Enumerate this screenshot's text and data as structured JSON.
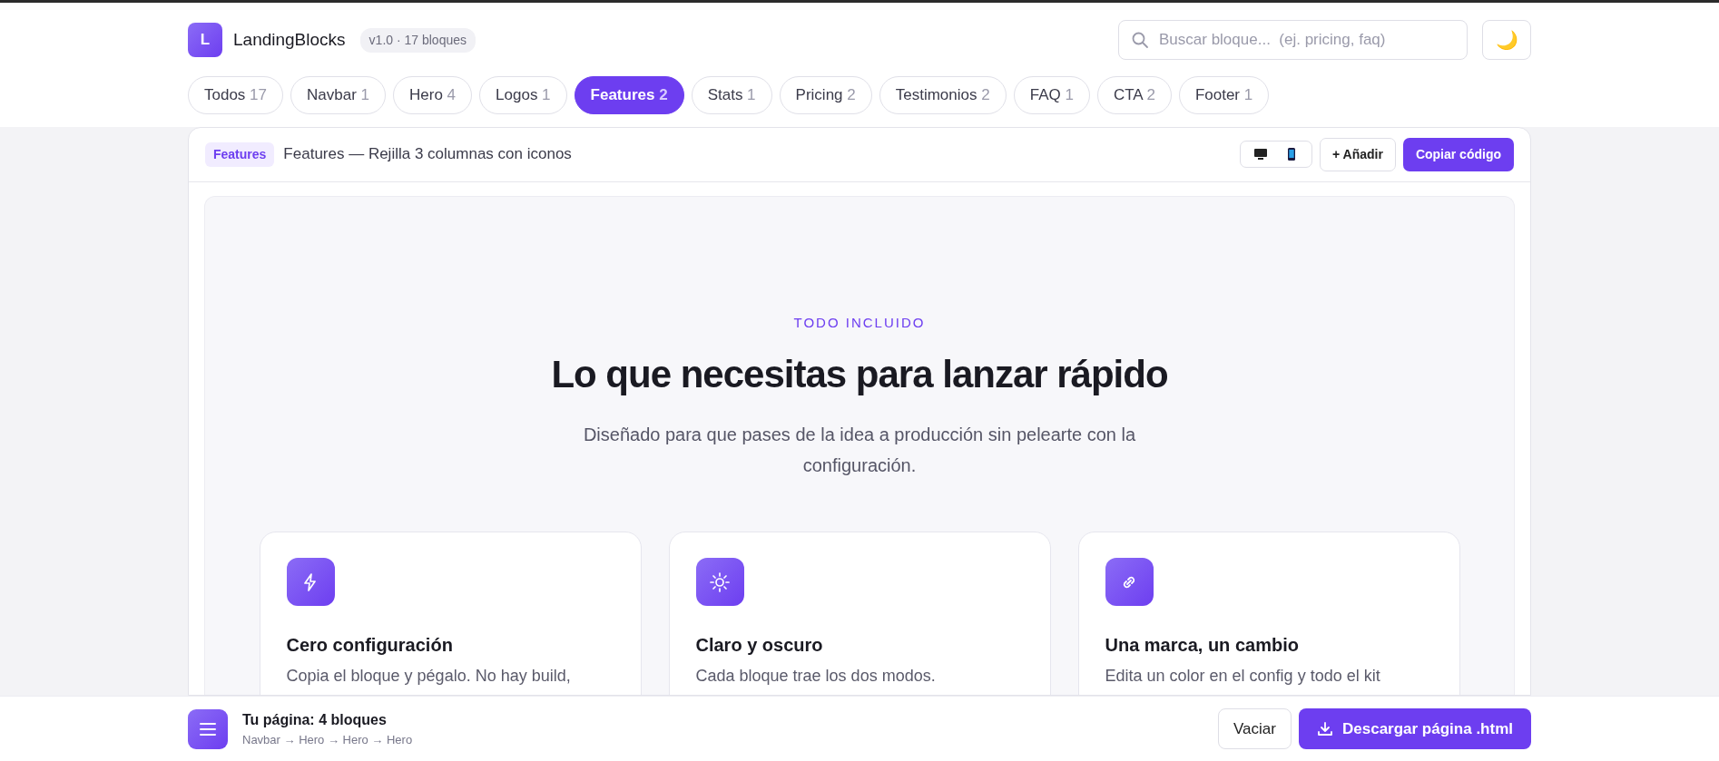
{
  "brand": {
    "logo_letter": "L",
    "name": "LandingBlocks",
    "version": "v1.0 · 17 bloques"
  },
  "search": {
    "placeholder": "Buscar bloque...  (ej. pricing, faq)"
  },
  "theme_toggle": {
    "glyph": "🌙"
  },
  "categories": [
    {
      "label": "Todos",
      "count": "17",
      "selected": false
    },
    {
      "label": "Navbar",
      "count": "1",
      "selected": false
    },
    {
      "label": "Hero",
      "count": "4",
      "selected": false
    },
    {
      "label": "Logos",
      "count": "1",
      "selected": false
    },
    {
      "label": "Features",
      "count": "2",
      "selected": true
    },
    {
      "label": "Stats",
      "count": "1",
      "selected": false
    },
    {
      "label": "Pricing",
      "count": "2",
      "selected": false
    },
    {
      "label": "Testimonios",
      "count": "2",
      "selected": false
    },
    {
      "label": "FAQ",
      "count": "1",
      "selected": false
    },
    {
      "label": "CTA",
      "count": "2",
      "selected": false
    },
    {
      "label": "Footer",
      "count": "1",
      "selected": false
    }
  ],
  "block": {
    "tag": "Features",
    "title": "Features — Rejilla 3 columnas con iconos",
    "viewports": [
      {
        "kind": "desktop",
        "selected": false
      },
      {
        "kind": "mobile",
        "selected": false
      }
    ],
    "add_button": "+ Añadir",
    "copy_button": "Copiar código"
  },
  "preview": {
    "eyebrow": "TODO INCLUIDO",
    "heading": "Lo que necesitas para lanzar rápido",
    "subtitle": "Diseñado para que pases de la idea a producción sin pelearte con la configuración.",
    "features": [
      {
        "kind": "bolt",
        "title": "Cero configuración",
        "text": "Copia el bloque y pégalo. No hay build,"
      },
      {
        "kind": "sun",
        "title": "Claro y oscuro",
        "text": "Cada bloque trae los dos modos."
      },
      {
        "kind": "link",
        "title": "Una marca, un cambio",
        "text": "Edita un color en el config y todo el kit"
      }
    ]
  },
  "page_bar": {
    "title": "Tu página: 4 bloques",
    "sequence": "Navbar → Hero → Hero → Hero",
    "clear_button": "Vaciar",
    "download_button": "Descargar página .html"
  }
}
